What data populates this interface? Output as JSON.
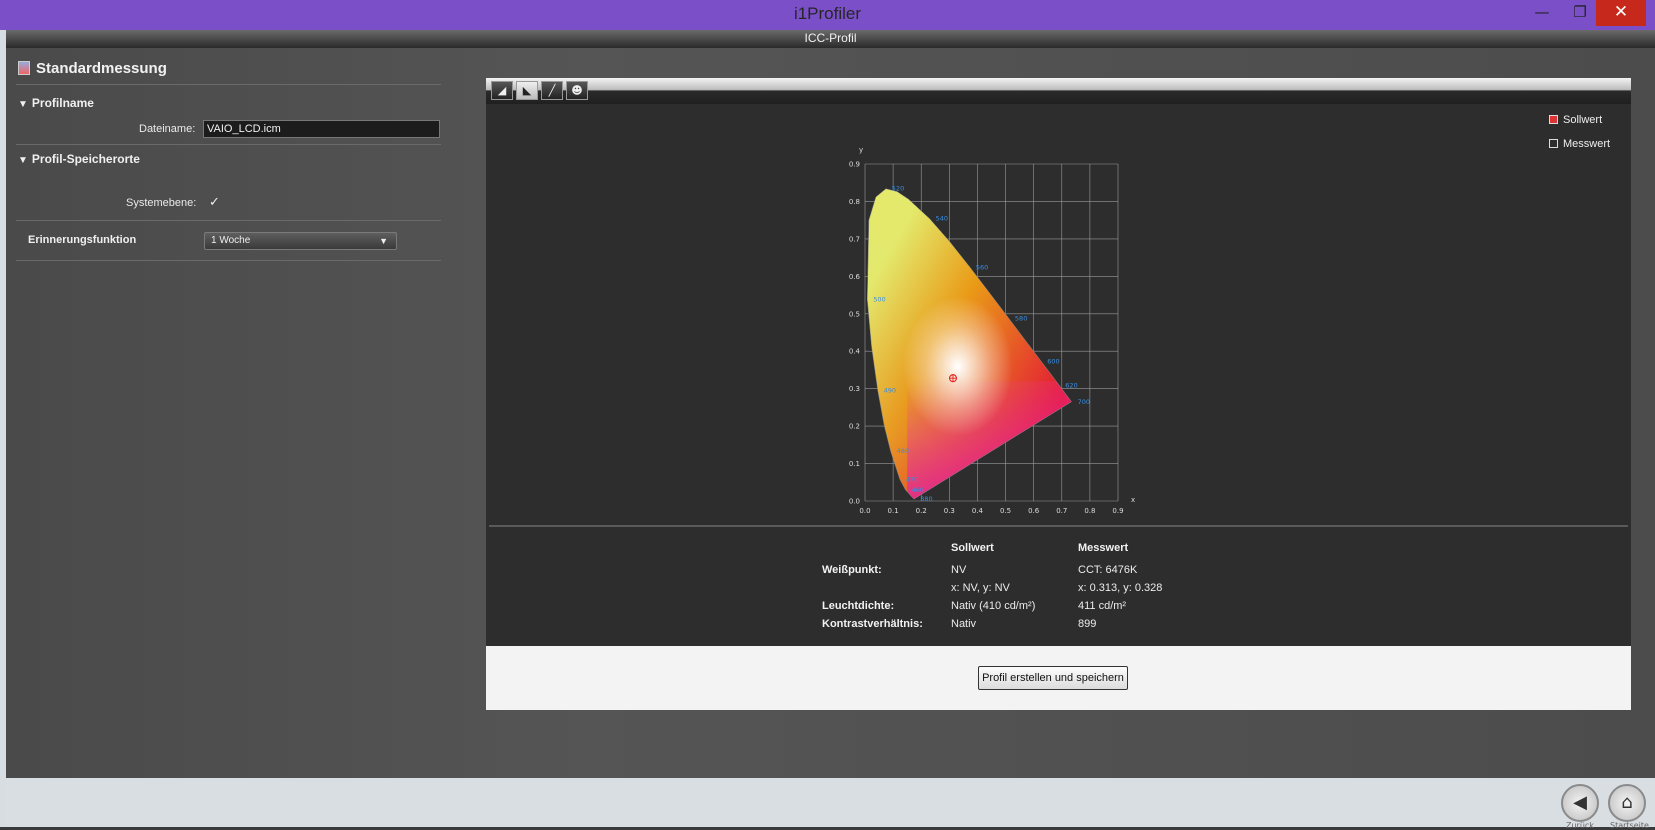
{
  "window": {
    "title": "i1Profiler",
    "subtitle": "ICC-Profil",
    "minimize": "—",
    "maximize": "❐",
    "close": "✕"
  },
  "left_panel": {
    "title": "Standardmessung",
    "profilname_label": "Profilname",
    "dateiname_label": "Dateiname:",
    "dateiname_value": "VAIO_LCD.icm",
    "speicherorte_label": "Profil-Speicherorte",
    "systemebene_label": "Systemebene:",
    "systemebene_checked": "✓",
    "erinnerung_label": "Erinnerungsfunktion",
    "erinnerung_value": "1 Woche"
  },
  "toolbar": {
    "icons": [
      "profile-icon",
      "gamut-icon",
      "curve-icon",
      "user-icon"
    ],
    "active_index": 1
  },
  "legend": {
    "sollwert": "Sollwert",
    "messwert": "Messwert"
  },
  "chart_data": {
    "type": "scatter",
    "title": "",
    "xlabel": "x",
    "ylabel": "y",
    "xlim": [
      0.0,
      0.9
    ],
    "ylim": [
      0.0,
      0.9
    ],
    "x_ticks": [
      "0.0",
      "0.1",
      "0.2",
      "0.3",
      "0.4",
      "0.5",
      "0.6",
      "0.7",
      "0.8",
      "0.9"
    ],
    "y_ticks": [
      "0.0",
      "0.1",
      "0.2",
      "0.3",
      "0.4",
      "0.5",
      "0.6",
      "0.7",
      "0.8",
      "0.9"
    ],
    "grid": true,
    "wavelength_labels": [
      {
        "label": "520",
        "x": 0.074,
        "y": 0.834
      },
      {
        "label": "540",
        "x": 0.23,
        "y": 0.754
      },
      {
        "label": "560",
        "x": 0.373,
        "y": 0.624
      },
      {
        "label": "580",
        "x": 0.512,
        "y": 0.487
      },
      {
        "label": "600",
        "x": 0.627,
        "y": 0.372
      },
      {
        "label": "620",
        "x": 0.691,
        "y": 0.308
      },
      {
        "label": "700",
        "x": 0.735,
        "y": 0.265
      },
      {
        "label": "500",
        "x": 0.008,
        "y": 0.538
      },
      {
        "label": "490",
        "x": 0.045,
        "y": 0.295
      },
      {
        "label": "480",
        "x": 0.091,
        "y": 0.133
      },
      {
        "label": "470",
        "x": 0.124,
        "y": 0.058
      },
      {
        "label": "460",
        "x": 0.144,
        "y": 0.03
      },
      {
        "label": "380",
        "x": 0.175,
        "y": 0.005
      }
    ],
    "series": [
      {
        "name": "Messwert",
        "x": [
          0.313
        ],
        "y": [
          0.328
        ]
      }
    ]
  },
  "table": {
    "col_sollwert": "Sollwert",
    "col_messwert": "Messwert",
    "rows": [
      {
        "label": "Weißpunkt:",
        "soll": "NV",
        "mess": "CCT: 6476K"
      },
      {
        "label": "",
        "soll": "x: NV, y: NV",
        "mess": "x: 0.313, y: 0.328"
      },
      {
        "label": "Leuchtdichte:",
        "soll": "Nativ (410 cd/m²)",
        "mess": "411 cd/m²"
      },
      {
        "label": "Kontrastverhältnis:",
        "soll": "Nativ",
        "mess": "899"
      }
    ]
  },
  "save_button": "Profil erstellen und speichern",
  "nav": {
    "back": "Zurück",
    "home": "Startseite"
  },
  "colors": {
    "titlebar": "#7a4fc8",
    "close": "#c7281c",
    "target_marker": "#e02020"
  }
}
